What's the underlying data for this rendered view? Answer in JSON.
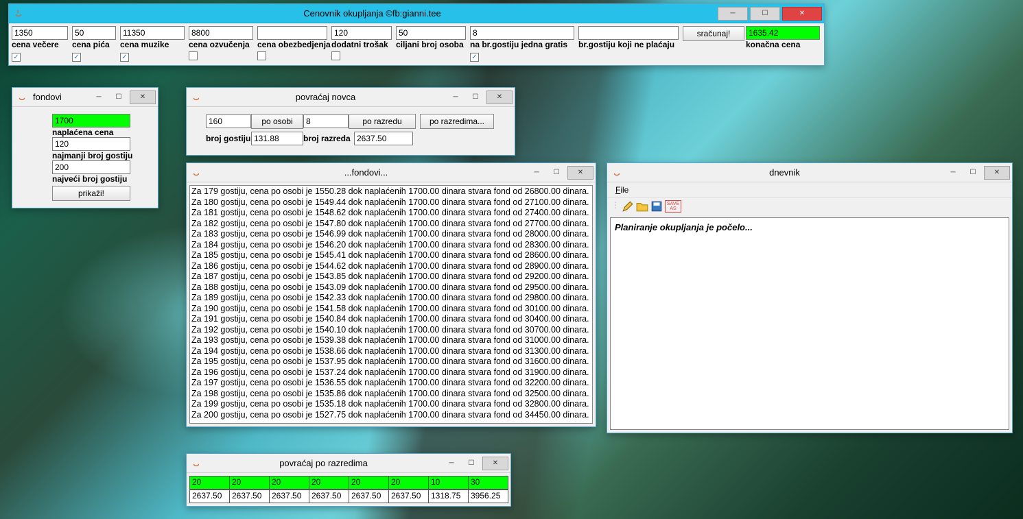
{
  "top_window": {
    "title": "Cenovnik okupljanja ©fb:gianni.tee",
    "cols": [
      {
        "value": "1350",
        "label": "cena večere",
        "checked": true
      },
      {
        "value": "50",
        "label": "cena pića",
        "checked": true
      },
      {
        "value": "11350",
        "label": "cena muzike",
        "checked": true
      },
      {
        "value": "8800",
        "label": "cena ozvučenja",
        "checked": false
      },
      {
        "value": "",
        "label": "cena obezbedjenja",
        "checked": false
      },
      {
        "value": "120",
        "label": "dodatni trošak",
        "checked": false
      },
      {
        "value": "50",
        "label": "ciljani broj osoba",
        "checked": null
      },
      {
        "value": "8",
        "label": "na br.gostiju jedna gratis",
        "checked": true
      },
      {
        "value": "",
        "label": "br.gostiju koji ne plaćaju",
        "checked": null
      }
    ],
    "calc_button": "sračunaj!",
    "result_value": "1635.42",
    "result_label": "konačna cena"
  },
  "fondovi": {
    "title": "fondovi",
    "highlight_value": "1700",
    "rows": [
      {
        "label": "naplaćena cena",
        "value": ""
      },
      {
        "label": "",
        "value": "120"
      },
      {
        "label": "najmanji broj gostiju",
        "value": ""
      },
      {
        "label": "",
        "value": "200"
      },
      {
        "label": "najveći broj gostiju",
        "value": ""
      }
    ],
    "label_naplacena": "naplaćena cena",
    "val_120": "120",
    "label_najmanji": "najmanji broj gostiju",
    "val_200": "200",
    "label_najveci": "najveći broj gostiju",
    "button": "prikaži!"
  },
  "povracaj": {
    "title": "povraćaj novca",
    "val_160": "160",
    "btn_po_osobi": "po osobi",
    "val_8": "8",
    "btn_po_razredu": "po razredu",
    "btn_po_razredima": "po razredima...",
    "label_broj_gostiju": "broj gostiju",
    "val_13188": "131.88",
    "label_broj_razreda": "broj razreda",
    "val_263750": "2637.50"
  },
  "fondovi_list": {
    "title": "...fondovi...",
    "lines": [
      "Za 179 gostiju, cena po osobi je 1550.28 dok naplaćenih 1700.00 dinara stvara fond od 26800.00 dinara.",
      "Za 180 gostiju, cena po osobi je 1549.44 dok naplaćenih 1700.00 dinara stvara fond od 27100.00 dinara.",
      "Za 181 gostiju, cena po osobi je 1548.62 dok naplaćenih 1700.00 dinara stvara fond od 27400.00 dinara.",
      "Za 182 gostiju, cena po osobi je 1547.80 dok naplaćenih 1700.00 dinara stvara fond od 27700.00 dinara.",
      "Za 183 gostiju, cena po osobi je 1546.99 dok naplaćenih 1700.00 dinara stvara fond od 28000.00 dinara.",
      "Za 184 gostiju, cena po osobi je 1546.20 dok naplaćenih 1700.00 dinara stvara fond od 28300.00 dinara.",
      "Za 185 gostiju, cena po osobi je 1545.41 dok naplaćenih 1700.00 dinara stvara fond od 28600.00 dinara.",
      "Za 186 gostiju, cena po osobi je 1544.62 dok naplaćenih 1700.00 dinara stvara fond od 28900.00 dinara.",
      "Za 187 gostiju, cena po osobi je 1543.85 dok naplaćenih 1700.00 dinara stvara fond od 29200.00 dinara.",
      "Za 188 gostiju, cena po osobi je 1543.09 dok naplaćenih 1700.00 dinara stvara fond od 29500.00 dinara.",
      "Za 189 gostiju, cena po osobi je 1542.33 dok naplaćenih 1700.00 dinara stvara fond od 29800.00 dinara.",
      "Za 190 gostiju, cena po osobi je 1541.58 dok naplaćenih 1700.00 dinara stvara fond od 30100.00 dinara.",
      "Za 191 gostiju, cena po osobi je 1540.84 dok naplaćenih 1700.00 dinara stvara fond od 30400.00 dinara.",
      "Za 192 gostiju, cena po osobi je 1540.10 dok naplaćenih 1700.00 dinara stvara fond od 30700.00 dinara.",
      "Za 193 gostiju, cena po osobi je 1539.38 dok naplaćenih 1700.00 dinara stvara fond od 31000.00 dinara.",
      "Za 194 gostiju, cena po osobi je 1538.66 dok naplaćenih 1700.00 dinara stvara fond od 31300.00 dinara.",
      "Za 195 gostiju, cena po osobi je 1537.95 dok naplaćenih 1700.00 dinara stvara fond od 31600.00 dinara.",
      "Za 196 gostiju, cena po osobi je 1537.24 dok naplaćenih 1700.00 dinara stvara fond od 31900.00 dinara.",
      "Za 197 gostiju, cena po osobi je 1536.55 dok naplaćenih 1700.00 dinara stvara fond od 32200.00 dinara.",
      "Za 198 gostiju, cena po osobi je 1535.86 dok naplaćenih 1700.00 dinara stvara fond od 32500.00 dinara.",
      "Za 199 gostiju, cena po osobi je 1535.18 dok naplaćenih 1700.00 dinara stvara fond od 32800.00 dinara.",
      "Za 200 gostiju, cena po osobi je 1527.75 dok naplaćenih 1700.00 dinara stvara fond od 34450.00 dinara."
    ]
  },
  "dnevnik": {
    "title": "dnevnik",
    "menu_file": "File",
    "toolbar_icons": [
      "pencil-icon",
      "folder-icon",
      "save-icon",
      "save-as-icon"
    ],
    "save_as_text": "SAVE AS",
    "content": "Planiranje okupljanja je počelo..."
  },
  "razredi": {
    "title": "povraćaj po razredima",
    "row1": [
      "20",
      "20",
      "20",
      "20",
      "20",
      "20",
      "10",
      "30"
    ],
    "row2": [
      "2637.50",
      "2637.50",
      "2637.50",
      "2637.50",
      "2637.50",
      "2637.50",
      "1318.75",
      "3956.25"
    ]
  }
}
